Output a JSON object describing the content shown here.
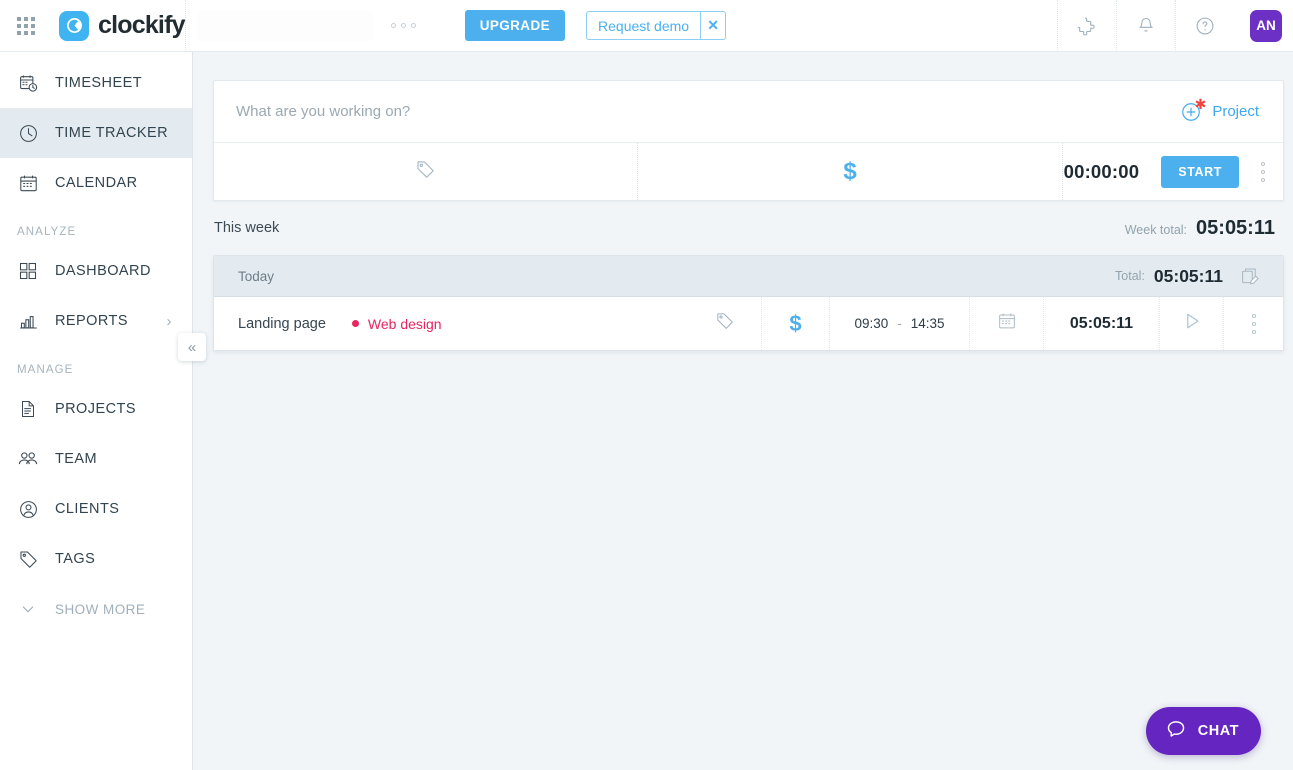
{
  "topbar": {
    "apps_grid_icon": "grid-apps-icon",
    "logo_text": "clockify",
    "logo_icon": "clockify-logo-icon",
    "workspace_menu_icon": "horizontal-dots-icon",
    "upgrade_label": "UPGRADE",
    "request_demo_label": "Request demo",
    "close_demo_label": "✕",
    "integrations_icon": "puzzle-piece-icon",
    "notifications_icon": "bell-icon",
    "help_icon": "question-circle-icon",
    "avatar_initials": "AN"
  },
  "sidebar": {
    "items": [
      {
        "label": "TIMESHEET",
        "icon": "timesheet-icon",
        "active": false
      },
      {
        "label": "TIME TRACKER",
        "icon": "clock-icon",
        "active": true
      },
      {
        "label": "CALENDAR",
        "icon": "calendar-icon",
        "active": false
      }
    ],
    "analyze_group": "ANALYZE",
    "analyze_items": [
      {
        "label": "DASHBOARD",
        "icon": "dashboard-grid-icon"
      },
      {
        "label": "REPORTS",
        "icon": "bar-chart-icon",
        "chevron": "›"
      }
    ],
    "manage_group": "MANAGE",
    "manage_items": [
      {
        "label": "PROJECTS",
        "icon": "document-icon"
      },
      {
        "label": "TEAM",
        "icon": "people-icon"
      },
      {
        "label": "CLIENTS",
        "icon": "person-circle-icon"
      },
      {
        "label": "TAGS",
        "icon": "tag-icon"
      }
    ],
    "show_more_label": "SHOW MORE",
    "show_more_icon": "chevron-down-icon",
    "collapse_icon": "«"
  },
  "timer": {
    "description_value": "",
    "description_placeholder": "What are you working on?",
    "project_label": "Project",
    "project_required_marker": "✱",
    "add_project_icon": "plus-circle-icon",
    "tag_icon": "tag-icon",
    "billable_icon": "dollar-icon",
    "billable_symbol": "$",
    "duration": "00:00:00",
    "start_label": "START",
    "more_icon": "vertical-dots-icon"
  },
  "week": {
    "label": "This week",
    "total_label": "Week total:",
    "total_value": "05:05:11"
  },
  "day": {
    "label": "Today",
    "total_label": "Total:",
    "total_value": "05:05:11",
    "bulk_edit_icon": "bulk-edit-icon"
  },
  "entries": [
    {
      "description": "Landing page",
      "project": "Web design",
      "project_color": "#e8255f",
      "tag_icon": "tag-icon",
      "billable_symbol": "$",
      "start_time": "09:30",
      "time_separator": "-",
      "end_time": "14:35",
      "calendar_icon": "calendar-icon",
      "duration": "05:05:11",
      "play_icon": "play-icon",
      "more_icon": "vertical-dots-icon"
    }
  ],
  "chat": {
    "label": "CHAT",
    "icon": "speech-bubble-icon"
  },
  "colors": {
    "accent_blue": "#4cb0ef",
    "avatar_purple": "#6c31c4",
    "chat_purple": "#6425c0",
    "project_pink": "#e8255f",
    "page_bg": "#f1f5f8"
  }
}
